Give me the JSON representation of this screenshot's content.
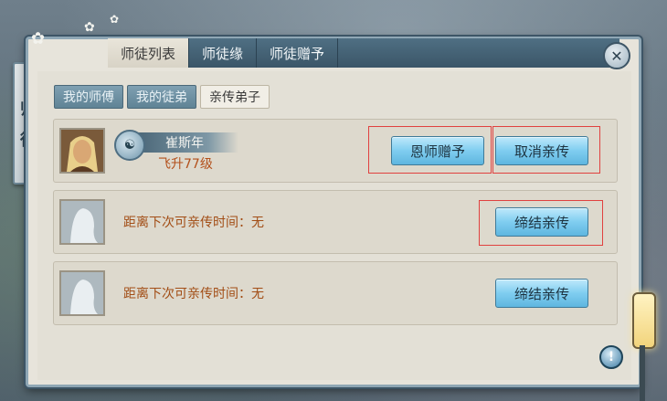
{
  "side_banner": {
    "char1": "师",
    "char2": "徒"
  },
  "tabs": [
    {
      "label": "师徒列表",
      "active": true
    },
    {
      "label": "师徒缘",
      "active": false
    },
    {
      "label": "师徒赠予",
      "active": false
    }
  ],
  "subtabs": [
    {
      "label": "我的师傅",
      "active": false
    },
    {
      "label": "我的徒弟",
      "active": false
    },
    {
      "label": "亲传弟子",
      "active": true
    }
  ],
  "disciple": {
    "name": "崔斯年",
    "level": "飞升77级",
    "gift_button": "恩师赠予",
    "cancel_button": "取消亲传"
  },
  "empty_slots": [
    {
      "wait_text": "距离下次可亲传时间：无",
      "button": "缔结亲传"
    },
    {
      "wait_text": "距离下次可亲传时间：无",
      "button": "缔结亲传"
    }
  ],
  "icons": {
    "close": "close-icon",
    "help": "help-icon",
    "emblem": "sect-emblem-icon"
  },
  "colors": {
    "accent": "#7fcdf0",
    "highlight_box": "#e0413f",
    "level_text": "#b3501b"
  }
}
